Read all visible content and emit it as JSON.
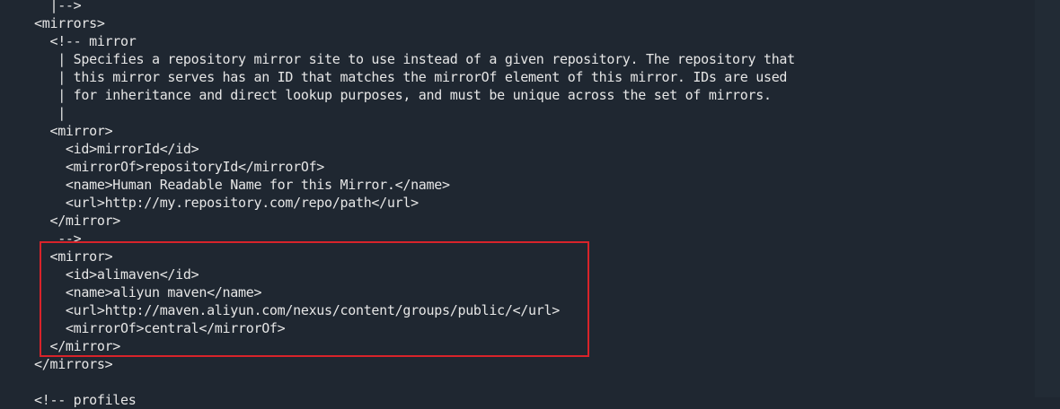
{
  "code": {
    "lines": [
      {
        "text": "  |-->"
      },
      {
        "text": "<mirrors>"
      },
      {
        "text": "  <!-- mirror"
      },
      {
        "text": "   | Specifies a repository mirror site to use instead of a given repository. The repository that"
      },
      {
        "text": "   | this mirror serves has an ID that matches the mirrorOf element of this mirror. IDs are used"
      },
      {
        "text": "   | for inheritance and direct lookup purposes, and must be unique across the set of mirrors."
      },
      {
        "text": "   |"
      },
      {
        "text": "  <mirror>"
      },
      {
        "text": "    <id>mirrorId</id>"
      },
      {
        "text": "    <mirrorOf>repositoryId</mirrorOf>"
      },
      {
        "text": "    <name>Human Readable Name for this Mirror.</name>"
      },
      {
        "text": "    <url>http://my.repository.com/repo/path</url>"
      },
      {
        "text": "  </mirror>"
      },
      {
        "text": "   -->"
      },
      {
        "text": "  <mirror>"
      },
      {
        "text": "    <id>alimaven</id>"
      },
      {
        "text": "    <name>aliyun maven</name>"
      },
      {
        "text": "    <url>http://maven.aliyun.com/nexus/content/groups/public/</url>"
      },
      {
        "text": "    <mirrorOf>central</mirrorOf>"
      },
      {
        "text": "  </mirror>"
      },
      {
        "text": "</mirrors>"
      },
      {
        "text": ""
      },
      {
        "text": "<!-- profiles"
      }
    ]
  },
  "colors": {
    "background": "#1f2731",
    "text": "#e6e6e6",
    "highlight_border": "#d8232a"
  }
}
